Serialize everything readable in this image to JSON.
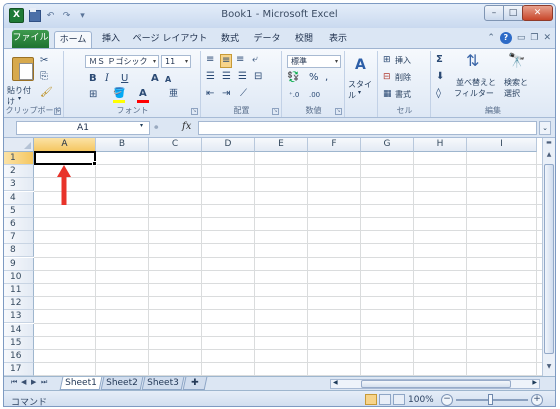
{
  "window": {
    "title": "Book1 - Microsoft Excel",
    "app_icon": "X",
    "minimize": "–",
    "maximize": "□",
    "close": "✕"
  },
  "qat": {
    "undo": "↶",
    "redo": "↷",
    "customize": "▾"
  },
  "tabs": {
    "file": "ファイル",
    "items": [
      "ホーム",
      "挿入",
      "ページ レイアウト",
      "数式",
      "データ",
      "校閲",
      "表示"
    ],
    "help": "?"
  },
  "ribbon": {
    "clipboard": {
      "label": "クリップボード",
      "paste": "貼り付け"
    },
    "font": {
      "label": "フォント",
      "name": "ＭＳ Ｐゴシック",
      "size": "11",
      "bold": "B",
      "italic": "I",
      "underline": "U",
      "grow": "A",
      "shrink": "A",
      "font_color_letter": "A",
      "phonetic": "亜"
    },
    "alignment": {
      "label": "配置"
    },
    "number": {
      "label": "数値",
      "format": "標準",
      "percent": "%",
      "comma": ","
    },
    "styles": {
      "label": "スタイル",
      "icon": "A"
    },
    "cells": {
      "label": "セル",
      "insert": "挿入",
      "delete": "削除",
      "format": "書式"
    },
    "editing": {
      "label": "編集",
      "sigma": "Σ",
      "sort_filter_1": "並べ替えと",
      "sort_filter_2": "フィルター",
      "find_select_1": "検索と",
      "find_select_2": "選択"
    }
  },
  "formula_bar": {
    "name_box": "A1",
    "fx": "fx",
    "value": ""
  },
  "grid": {
    "columns": [
      "A",
      "B",
      "C",
      "D",
      "E",
      "F",
      "G",
      "H",
      "I"
    ],
    "rows": [
      "1",
      "2",
      "3",
      "4",
      "5",
      "6",
      "7",
      "8",
      "9",
      "10",
      "11",
      "12",
      "13",
      "14",
      "15",
      "16",
      "17"
    ],
    "active_cell": "A1"
  },
  "sheets": {
    "names": [
      "Sheet1",
      "Sheet2",
      "Sheet3"
    ],
    "active": "Sheet1"
  },
  "status_bar": {
    "mode": "コマンド",
    "zoom": "100%",
    "zoom_minus": "−",
    "zoom_plus": "+"
  },
  "colors": {
    "annotation_arrow": "#e8332a",
    "selection_header": "#f5c761",
    "file_tab": "#1e7331"
  }
}
